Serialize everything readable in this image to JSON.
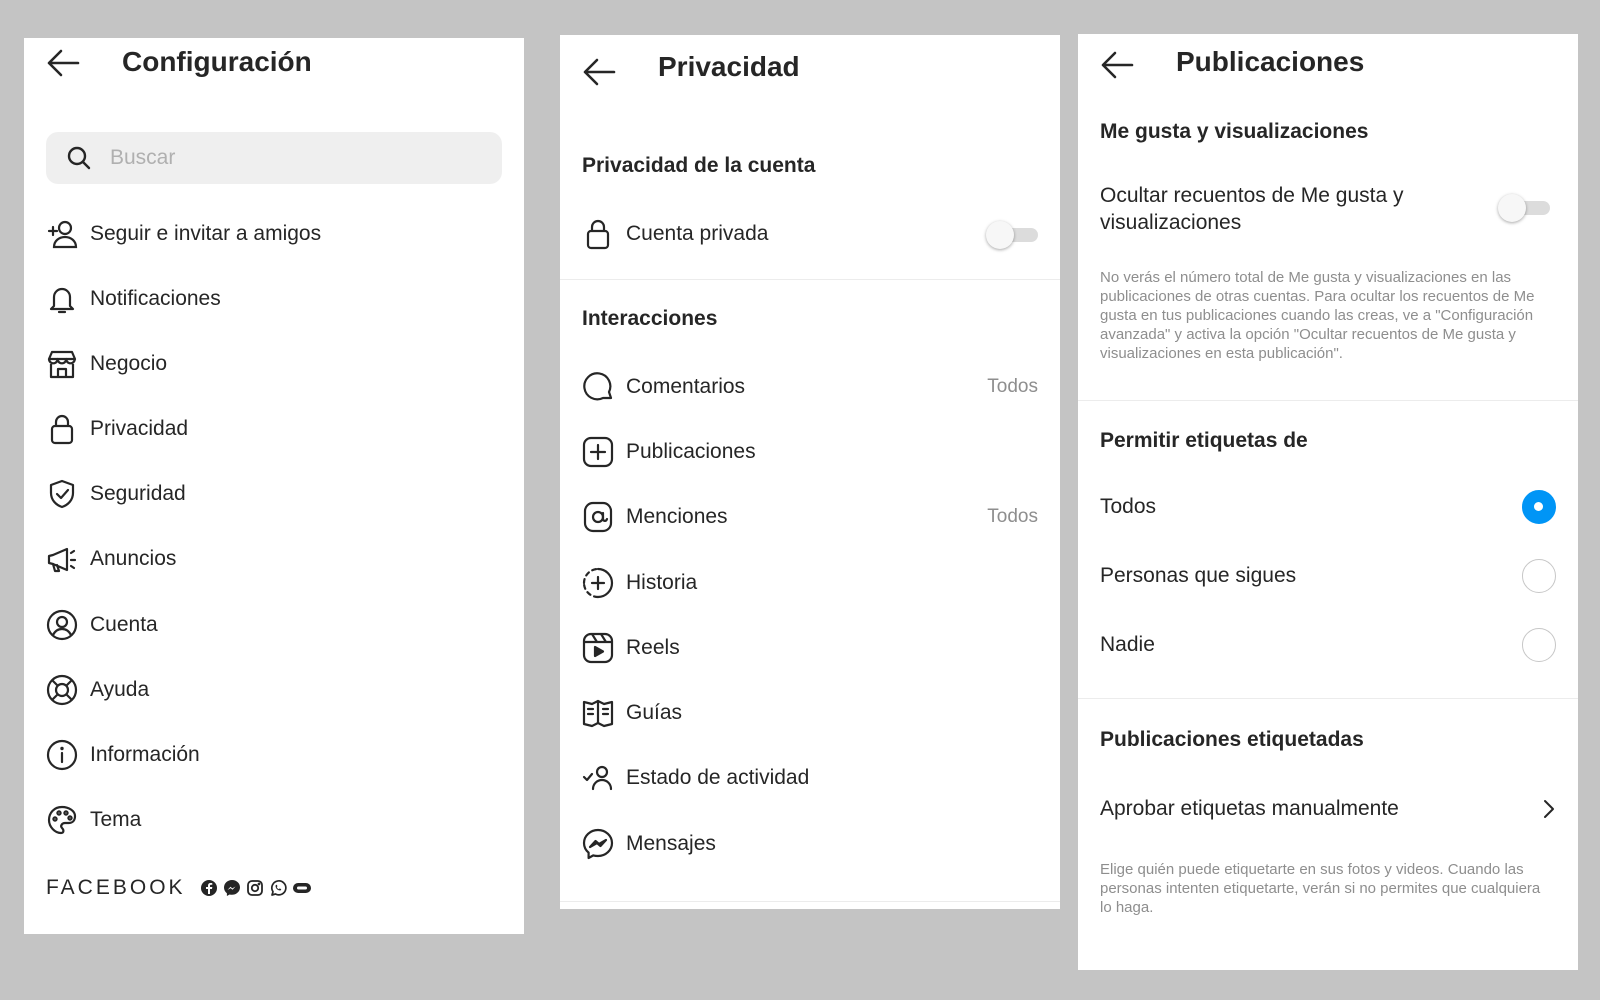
{
  "settings": {
    "title": "Configuración",
    "search_placeholder": "Buscar",
    "items": [
      {
        "label": "Seguir e invitar a amigos",
        "icon": "add-person-icon"
      },
      {
        "label": "Notificaciones",
        "icon": "bell-icon"
      },
      {
        "label": "Negocio",
        "icon": "shop-icon"
      },
      {
        "label": "Privacidad",
        "icon": "lock-icon"
      },
      {
        "label": "Seguridad",
        "icon": "shield-check-icon"
      },
      {
        "label": "Anuncios",
        "icon": "megaphone-icon"
      },
      {
        "label": "Cuenta",
        "icon": "user-circle-icon"
      },
      {
        "label": "Ayuda",
        "icon": "lifebuoy-icon"
      },
      {
        "label": "Información",
        "icon": "info-icon"
      },
      {
        "label": "Tema",
        "icon": "palette-icon"
      }
    ],
    "footer_brand": "FACEBOOK"
  },
  "privacy": {
    "title": "Privacidad",
    "account_section": "Privacidad de la cuenta",
    "private_account_label": "Cuenta privada",
    "private_account_on": false,
    "interactions_section": "Interacciones",
    "items": [
      {
        "label": "Comentarios",
        "value": "Todos",
        "icon": "comment-icon"
      },
      {
        "label": "Publicaciones",
        "value": "",
        "icon": "add-square-icon"
      },
      {
        "label": "Menciones",
        "value": "Todos",
        "icon": "at-sign-icon"
      },
      {
        "label": "Historia",
        "value": "",
        "icon": "story-add-icon"
      },
      {
        "label": "Reels",
        "value": "",
        "icon": "reels-icon"
      },
      {
        "label": "Guías",
        "value": "",
        "icon": "guide-book-icon"
      },
      {
        "label": "Estado de actividad",
        "value": "",
        "icon": "activity-status-icon"
      },
      {
        "label": "Mensajes",
        "value": "",
        "icon": "messenger-icon"
      }
    ]
  },
  "posts": {
    "title": "Publicaciones",
    "likes_section": "Me gusta y visualizaciones",
    "hide_counts_label": "Ocultar recuentos de Me gusta y visualizaciones",
    "hide_counts_on": false,
    "hide_counts_help": "No verás el número total de Me gusta y visualizaciones en las publicaciones de otras cuentas. Para ocultar los recuentos de Me gusta en tus publicaciones cuando las creas, ve a \"Configuración avanzada\" y activa la opción \"Ocultar recuentos de Me gusta y visualizaciones en esta publicación\".",
    "tags_section": "Permitir etiquetas de",
    "tag_options": [
      {
        "label": "Todos",
        "selected": true
      },
      {
        "label": "Personas que sigues",
        "selected": false
      },
      {
        "label": "Nadie",
        "selected": false
      }
    ],
    "tagged_section": "Publicaciones etiquetadas",
    "manual_approve_label": "Aprobar etiquetas manualmente",
    "tagged_help": "Elige quién puede etiquetarte en sus fotos y videos. Cuando las personas intenten etiquetarte, verán si no permites que cualquiera lo haga."
  },
  "colors": {
    "accent": "#0095f6",
    "text": "#262626",
    "muted": "#8e8e8e"
  }
}
